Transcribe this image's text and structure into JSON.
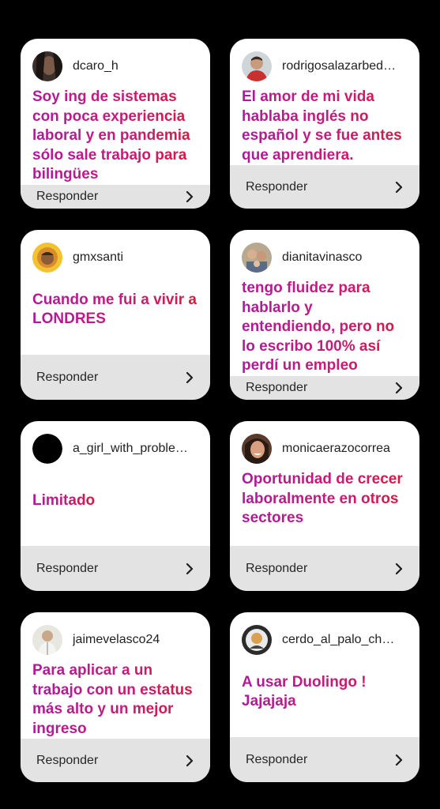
{
  "reply_label": "Responder",
  "colors": {
    "background": "#000000",
    "card": "#ffffff",
    "reply_bar": "#e3e3e3",
    "text_gradient_start": "#b0199a",
    "text_gradient_end": "#d51b3d"
  },
  "cards": [
    {
      "username": "dcaro_h",
      "answer": "Soy ing de sistemas con poca experiencia laboral y en pandemia sólo sale trabajo para bilingües",
      "avatar_icon": "avatar-photo-dark-hair"
    },
    {
      "username": "rodrigosalazarbed…",
      "answer": "El amor de mi vida hablaba inglés no español y se fue antes que aprendiera.",
      "avatar_icon": "avatar-photo-man-red-shirt"
    },
    {
      "username": "gmxsanti",
      "answer": "Cuando me fui a vivir a LONDRES",
      "avatar_icon": "avatar-photo-yellow-ring"
    },
    {
      "username": "dianitavinasco",
      "answer": "tengo fluidez para hablarlo y entendiendo, pero no lo escribo  100% así perdí un empleo",
      "avatar_icon": "avatar-photo-family"
    },
    {
      "username": "a_girl_with_proble…",
      "answer": "Limitado",
      "avatar_icon": "avatar-black-circle"
    },
    {
      "username": "monicaerazocorrea",
      "answer": "Oportunidad de crecer laboralmente en otros sectores",
      "avatar_icon": "avatar-photo-woman-smiling"
    },
    {
      "username": "jaimevelasco24",
      "answer": "Para aplicar a un trabajo con un estatus más alto y un mejor ingreso",
      "avatar_icon": "avatar-photo-light"
    },
    {
      "username": "cerdo_al_palo_ch…",
      "answer": "A usar Duolingo ! Jajajaja",
      "avatar_icon": "avatar-photo-logo"
    }
  ]
}
